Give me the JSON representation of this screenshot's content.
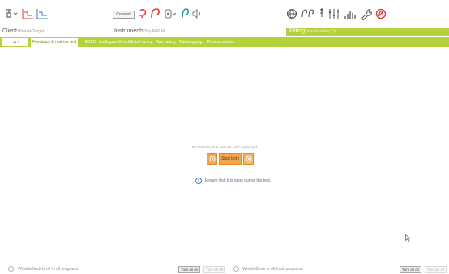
{
  "toolbar": {
    "connect_label": "Connect"
  },
  "info_bar": {
    "client_label": "Client",
    "client_value": "Phonak Target",
    "instruments_label": "Instruments",
    "instruments_value": "Sky M90 M",
    "fitting_label": "Fitting",
    "fitting_value": "Calm situation (1)"
  },
  "tabs": {
    "nav_label": "‹ ⇆ ›",
    "items": [
      {
        "label": "Feedback & real ear test",
        "active": true
      },
      {
        "label": "ECLD",
        "active": false
      },
      {
        "label": "AudiogramDirect",
        "active": false
      },
      {
        "label": "Global tuning",
        "active": false
      },
      {
        "label": "Fine tuning",
        "active": false
      },
      {
        "label": "DataLogging",
        "active": false
      },
      {
        "label": "Device options",
        "active": false
      }
    ]
  },
  "main": {
    "status_message": "No \"Feedback & real ear test\" measured",
    "start_button_label": "Start both",
    "info_message": "Ensure that it is quiet during the test."
  },
  "bottom_bar": {
    "left": {
      "status_text": "WhistleBlock is off in all programs",
      "turn_on_label": "Turn all on",
      "turn_off_label": "Turn all off"
    },
    "right": {
      "status_text": "WhistleBlock is off in all programs",
      "turn_on_label": "Turn all on",
      "turn_off_label": "Turn all off"
    }
  },
  "colors": {
    "accent_green": "#b3d23b",
    "start_orange": "#f4a64f",
    "icon_red": "#e2372b",
    "icon_teal": "#1a9a9a"
  },
  "icons": [
    "hearing-aid-device-icon",
    "audiogram-left-icon",
    "audiogram-right-icon",
    "hearing-aid-red-icon",
    "ear-red-icon",
    "speaker-device-icon",
    "ear-teal-icon",
    "sound-waves-icon",
    "globe-icon",
    "ears-icon",
    "person-icon",
    "sliders-icon",
    "bar-levels-icon",
    "wrench-icon",
    "no-hearing-icon"
  ]
}
